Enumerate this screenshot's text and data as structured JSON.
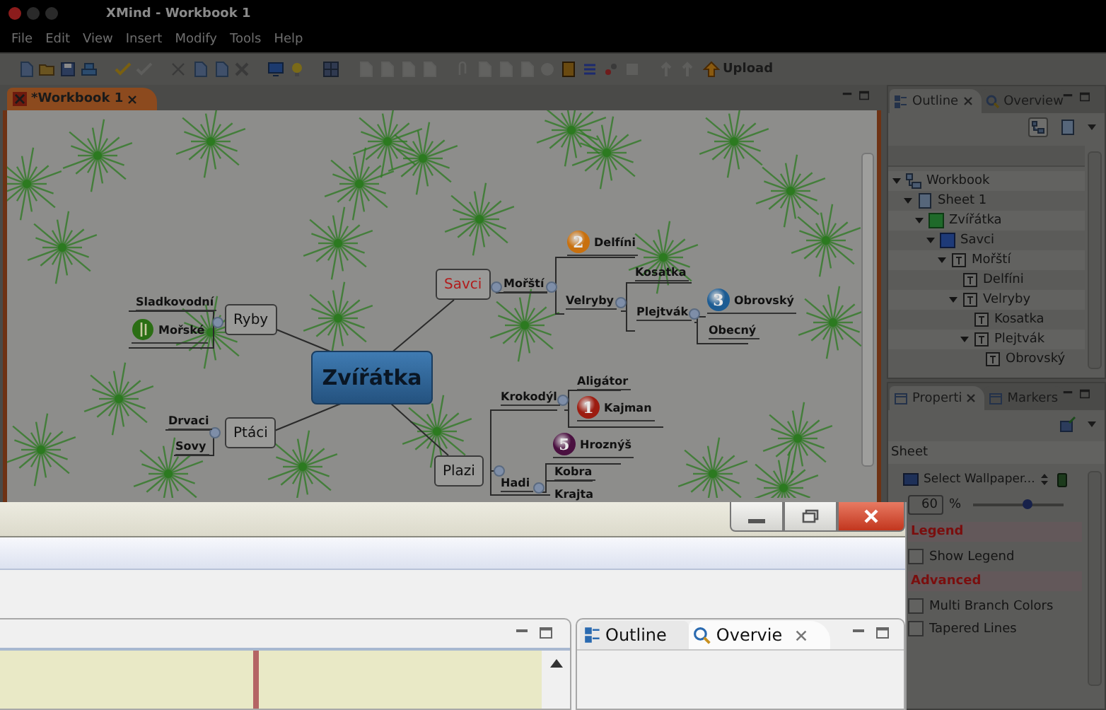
{
  "window": {
    "title": "XMind - Workbook 1"
  },
  "menu": [
    "File",
    "Edit",
    "View",
    "Insert",
    "Modify",
    "Tools",
    "Help"
  ],
  "toolbar": {
    "upload": "Upload"
  },
  "editor": {
    "tabs": [
      {
        "label": "*Workbook 1",
        "selected": true
      }
    ]
  },
  "mindmap": {
    "label": "Zvířátka",
    "children": [
      {
        "label": "Ryby",
        "color": "#111111",
        "children": [
          {
            "label": "Sladkovodní"
          },
          {
            "label": "Mořské",
            "marker": {
              "kind": "symbol",
              "color": "#2b6e14"
            }
          }
        ]
      },
      {
        "label": "Ptáci",
        "color": "#111111",
        "children": [
          {
            "label": "Drvaci"
          },
          {
            "label": "Sovy"
          }
        ]
      },
      {
        "label": "Savci",
        "color": "#b21c1c",
        "children": [
          {
            "label": "Mořští",
            "children": [
              {
                "label": "Delfíni",
                "marker": {
                  "kind": "priority",
                  "label": "2",
                  "color": "#c8700e"
                }
              },
              {
                "label": "Velryby",
                "children": [
                  {
                    "label": "Kosatka"
                  },
                  {
                    "label": "Plejtvák",
                    "children": [
                      {
                        "label": "Obrovský",
                        "marker": {
                          "kind": "priority",
                          "label": "3",
                          "color": "#1d5c93"
                        }
                      },
                      {
                        "label": "Obecný"
                      }
                    ]
                  }
                ]
              }
            ]
          }
        ]
      },
      {
        "label": "Plazi",
        "color": "#111111",
        "children": [
          {
            "label": "Krokodýl",
            "children": [
              {
                "label": "Aligátor"
              },
              {
                "label": "Kajman",
                "marker": {
                  "kind": "priority",
                  "label": "1",
                  "color": "#9c1c10"
                }
              }
            ]
          },
          {
            "label": "Hadi",
            "children": [
              {
                "label": "Hroznýš",
                "marker": {
                  "kind": "priority",
                  "label": "5",
                  "color": "#4a1040"
                }
              },
              {
                "label": "Kobra"
              },
              {
                "label": "Krajta"
              }
            ]
          }
        ]
      }
    ]
  },
  "outline": {
    "tabs": [
      {
        "label": "Outline",
        "selected": true
      },
      {
        "label": "Overview",
        "selected": false
      }
    ],
    "tree": [
      {
        "label": "Workbook",
        "kind": "workbook",
        "expanded": true,
        "children": [
          {
            "label": "Sheet 1",
            "kind": "sheet",
            "expanded": true,
            "children": [
              {
                "label": "Zvířátka",
                "kind": "central",
                "expanded": true,
                "children": [
                  {
                    "label": "Savci",
                    "kind": "main",
                    "expanded": true,
                    "children": [
                      {
                        "label": "Mořští",
                        "kind": "topic",
                        "expanded": true,
                        "children": [
                          {
                            "label": "Delfíni",
                            "kind": "topic"
                          },
                          {
                            "label": "Velryby",
                            "kind": "topic",
                            "expanded": true,
                            "children": [
                              {
                                "label": "Kosatka",
                                "kind": "topic"
                              },
                              {
                                "label": "Plejtvák",
                                "kind": "topic",
                                "expanded": true,
                                "children": [
                                  {
                                    "label": "Obrovský",
                                    "kind": "topic"
                                  }
                                ]
                              }
                            ]
                          }
                        ]
                      }
                    ]
                  }
                ]
              }
            ]
          }
        ]
      }
    ]
  },
  "properties": {
    "tabs": [
      {
        "label": "Properti",
        "selected": true
      },
      {
        "label": "Markers",
        "selected": false
      }
    ],
    "section": "Sheet",
    "wallpaper": "Select Wallpaper...",
    "opacity": {
      "value": "60",
      "unit": "%",
      "level": 0.6
    },
    "groups": [
      {
        "title": "Legend",
        "options": [
          {
            "label": "Show Legend",
            "checked": false
          }
        ]
      },
      {
        "title": "Advanced",
        "options": [
          {
            "label": "Multi Branch Colors",
            "checked": false
          },
          {
            "label": "Tapered Lines",
            "checked": false
          }
        ]
      }
    ]
  },
  "front_window": {
    "tabs": [
      {
        "label": "Outline",
        "selected": false
      },
      {
        "label": "Overvie",
        "selected": true
      }
    ]
  }
}
